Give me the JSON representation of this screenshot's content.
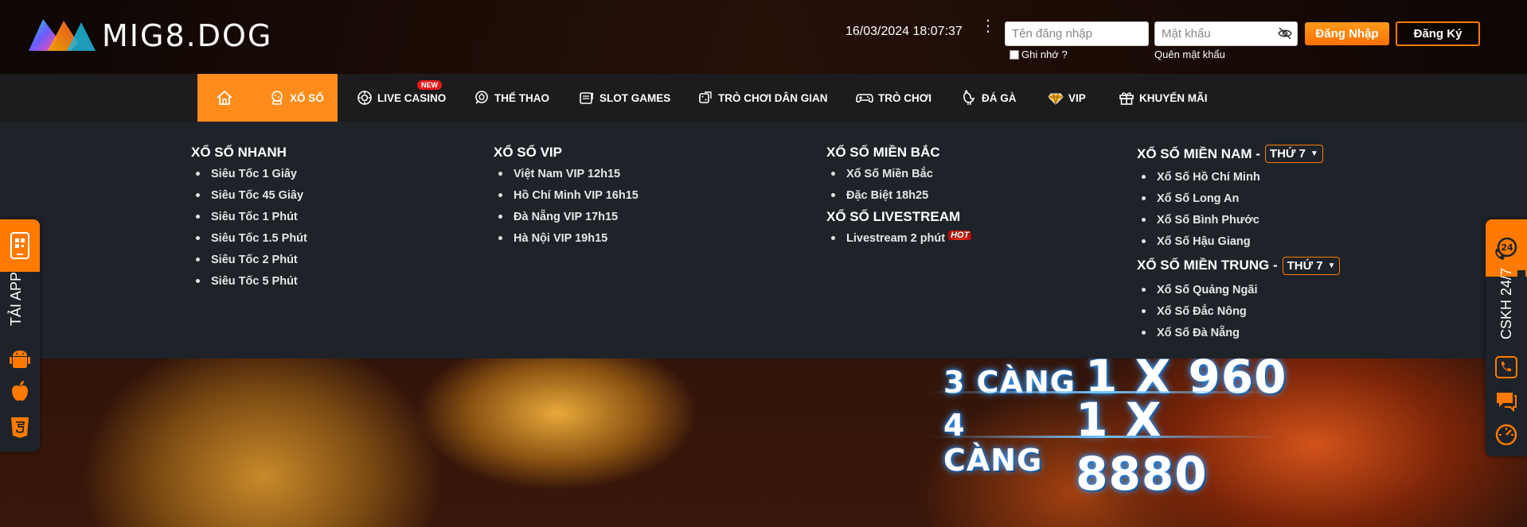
{
  "brand": {
    "logo_text": "MIG8.DOG"
  },
  "header": {
    "datetime": "16/03/2024 18:07:37",
    "username_placeholder": "Tên đăng nhập",
    "password_placeholder": "Mật khẩu",
    "remember_label": "Ghi nhớ ?",
    "forgot_label": "Quên mật khẩu",
    "login_label": "Đăng Nhập",
    "register_label": "Đăng Ký"
  },
  "nav": {
    "items": [
      {
        "label": "XỔ SỐ",
        "icon": "lottery-icon"
      },
      {
        "label": "LIVE CASINO",
        "icon": "casino-chip-icon",
        "badge": "NEW"
      },
      {
        "label": "THỂ THAO",
        "icon": "football-icon"
      },
      {
        "label": "SLOT GAMES",
        "icon": "slot-machine-icon"
      },
      {
        "label": "TRÒ CHƠI DÂN GIAN",
        "icon": "dice-icon"
      },
      {
        "label": "TRÒ CHƠI",
        "icon": "gamepad-icon"
      },
      {
        "label": "ĐÁ GÀ",
        "icon": "rooster-icon"
      },
      {
        "label": "VIP",
        "icon": "diamond-icon"
      },
      {
        "label": "KHUYẾN MÃI",
        "icon": "gift-icon"
      }
    ]
  },
  "dropdown": {
    "fast": {
      "title": "XỔ SỐ NHANH",
      "items": [
        "Siêu Tốc 1 Giây",
        "Siêu Tốc 45 Giây",
        "Siêu Tốc 1 Phút",
        "Siêu Tốc 1.5 Phút",
        "Siêu Tốc 2 Phút",
        "Siêu Tốc 5 Phút"
      ]
    },
    "vip": {
      "title": "XỔ SỐ VIP",
      "items": [
        "Việt Nam VIP 12h15",
        "Hồ Chí Minh VIP 16h15",
        "Đà Nẵng VIP 17h15",
        "Hà Nội VIP 19h15"
      ]
    },
    "north": {
      "title": "XỔ SỐ MIỀN BẮC",
      "items": [
        "Xổ Số Miền Bắc",
        "Đặc Biệt 18h25"
      ]
    },
    "livestream": {
      "title": "XỔ SỐ LIVESTREAM",
      "items": [
        "Livestream 2 phút"
      ],
      "badge": "HOT"
    },
    "south": {
      "title": "XỔ SỐ MIỀN NAM -",
      "day": "THỨ 7",
      "items": [
        "Xổ Số Hồ Chí Minh",
        "Xổ Số Long An",
        "Xổ Số Bình Phước",
        "Xổ Số Hậu Giang"
      ]
    },
    "central": {
      "title": "XỔ SỐ MIỀN TRUNG -",
      "day": "THỨ 7",
      "items": [
        "Xổ Số Quảng Ngãi",
        "Xổ Số Đắc Nông",
        "Xổ Số Đà Nẵng"
      ]
    }
  },
  "side_left": {
    "label": "TẢI APP"
  },
  "side_right": {
    "label": "CSKH 24/7",
    "badge": "24"
  },
  "banner": {
    "line1_prefix": "3 CÀNG",
    "line1_value": "1 X 960",
    "line2_prefix": "4 CÀNG",
    "line2_value": "1 X 8880"
  },
  "colors": {
    "accent": "#ff8c1a",
    "nav_bg": "#1c1c1e",
    "dropdown_bg": "#1e2329",
    "new_badge": "#e51a1a"
  }
}
